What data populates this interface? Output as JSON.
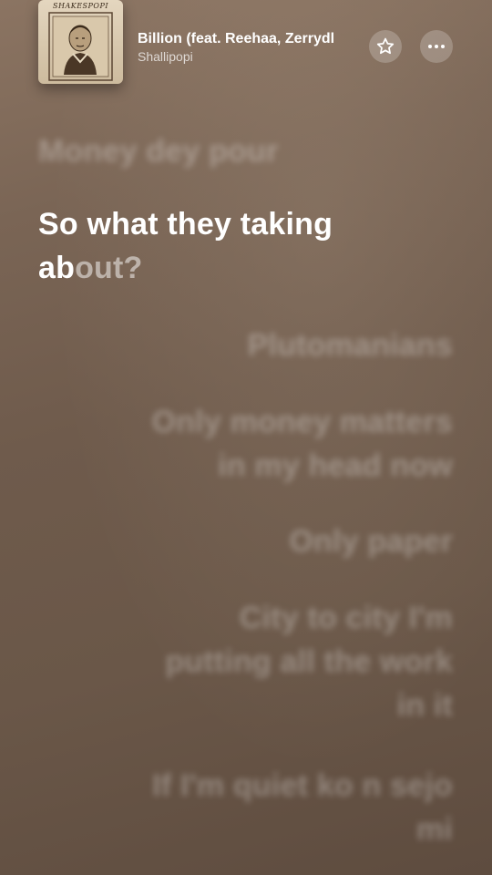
{
  "now_playing": {
    "title": "Billion (feat. Reehaa, Zerrydl",
    "artist": "Shallipopi",
    "album_art_text": "SHAKESPOPI"
  },
  "controls": {
    "favorite_icon": "star-outline-icon",
    "more_icon": "ellipsis-icon"
  },
  "lyrics": {
    "previous_line": "Money dey pour",
    "current_line_1": "So what they taking",
    "current_line_2_sung": "ab",
    "current_line_2_rest": "out?",
    "upcoming": [
      "Plutomanians",
      "Only money matters",
      "in my head now",
      "Only paper",
      "City to city I'm",
      "putting all the work",
      "in it",
      "If I'm quiet ko n sejo",
      "mi"
    ]
  },
  "colors": {
    "background": "#74604f",
    "active_lyric": "#ffffff",
    "inactive_lyric": "rgba(255,255,255,0.30)"
  }
}
